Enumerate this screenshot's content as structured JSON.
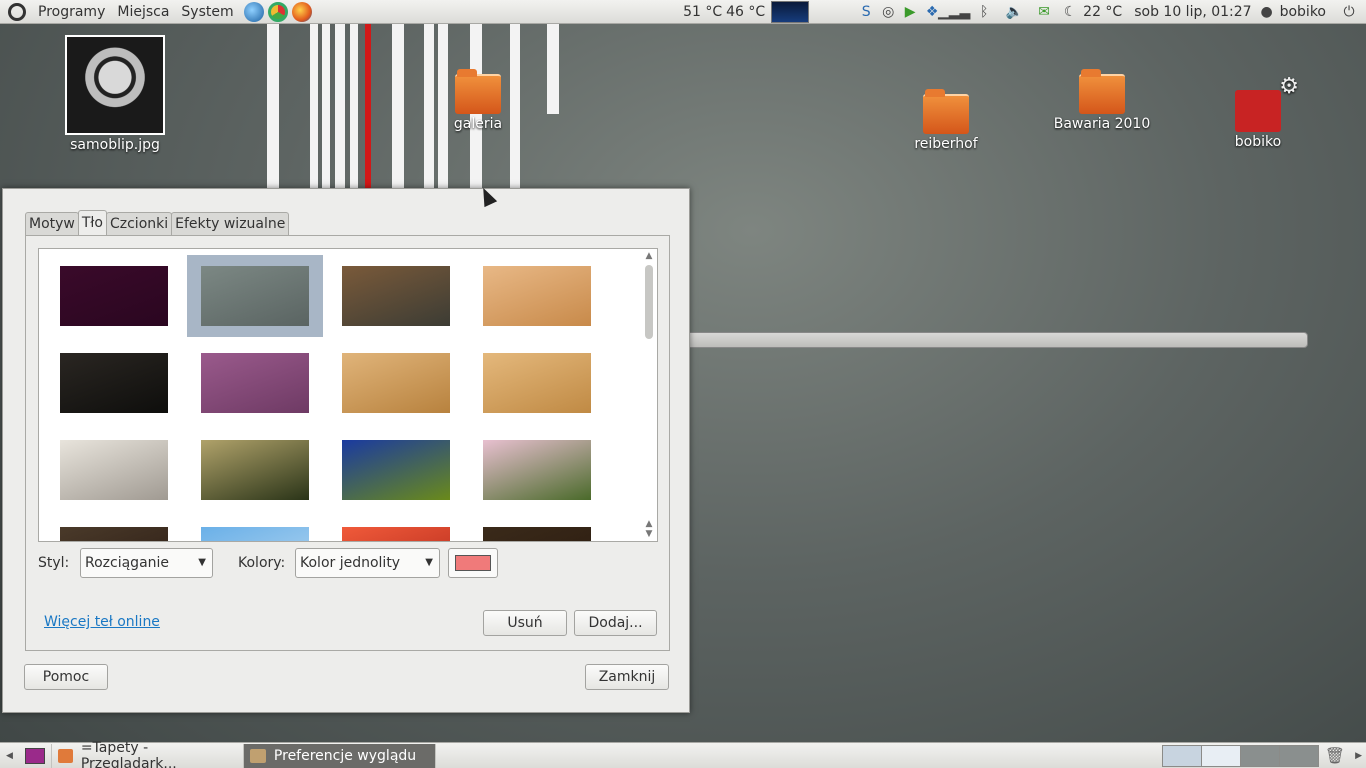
{
  "top_panel": {
    "menus": [
      "Programy",
      "Miejsca",
      "System"
    ],
    "cpu_temp": "51 °C",
    "gpu_temp": "46 °C",
    "weather": "22 °C",
    "datetime": "sob 10 lip, 01:27",
    "user": "bobiko"
  },
  "desktop": {
    "icons": [
      {
        "label": "samoblip.jpg",
        "type": "image"
      },
      {
        "label": "galeria",
        "type": "folder"
      },
      {
        "label": "reiberhof",
        "type": "folder"
      },
      {
        "label": "Bawaria 2010",
        "type": "folder"
      },
      {
        "label": "bobiko",
        "type": "computer"
      }
    ]
  },
  "dialog": {
    "tabs": [
      "Motyw",
      "Tło",
      "Czcionki",
      "Efekty wizualne"
    ],
    "active_tab": "Tło",
    "wallpapers": [
      {
        "colors": [
          "#3a0a2a",
          "#2a0620"
        ],
        "selected": false
      },
      {
        "colors": [
          "#7c8884",
          "#5a6462"
        ],
        "selected": true
      },
      {
        "colors": [
          "#7a5a3a",
          "#3c3c34"
        ],
        "selected": false
      },
      {
        "colors": [
          "#e8b886",
          "#c88a4a"
        ],
        "selected": false
      },
      {
        "colors": [
          "#2a2622",
          "#0e0e0c"
        ],
        "selected": false
      },
      {
        "colors": [
          "#9a5a8c",
          "#6e3a64"
        ],
        "selected": false
      },
      {
        "colors": [
          "#e0b47a",
          "#b8823e"
        ],
        "selected": false
      },
      {
        "colors": [
          "#e4b87c",
          "#c08a44"
        ],
        "selected": false
      },
      {
        "colors": [
          "#e8e4dc",
          "#a09a92"
        ],
        "selected": false
      },
      {
        "colors": [
          "#b0a26a",
          "#2a3418"
        ],
        "selected": false
      },
      {
        "colors": [
          "#1a3aa0",
          "#6a8a1a"
        ],
        "selected": false
      },
      {
        "colors": [
          "#e8c0d0",
          "#4a6a2a"
        ],
        "selected": false
      },
      {
        "colors": [
          "#4a3a2a",
          "#2a1a12"
        ],
        "selected": false
      },
      {
        "colors": [
          "#6ab0e8",
          "#b8d8f0"
        ],
        "selected": false
      },
      {
        "colors": [
          "#f05a3a",
          "#b0281a"
        ],
        "selected": false
      },
      {
        "colors": [
          "#3a2a1a",
          "#2a1a0e"
        ],
        "selected": false
      }
    ],
    "style_label": "Styl:",
    "style_value": "Rozciąganie",
    "colors_label": "Kolory:",
    "colors_value": "Kolor jednolity",
    "solid_color": "#f07a7a",
    "more_link": "Więcej teł online",
    "remove_button": "Usuń",
    "add_button": "Dodaj...",
    "help_button": "Pomoc",
    "close_button": "Zamknij"
  },
  "bottom_panel": {
    "tasks": [
      {
        "label": "=Tapety - Przeglądark...",
        "active": false
      },
      {
        "label": "Preferencje wyglądu",
        "active": true
      }
    ]
  },
  "icons": [
    "ubuntu-logo-icon",
    "gear-icon",
    "folder-icon",
    "trash-icon"
  ]
}
